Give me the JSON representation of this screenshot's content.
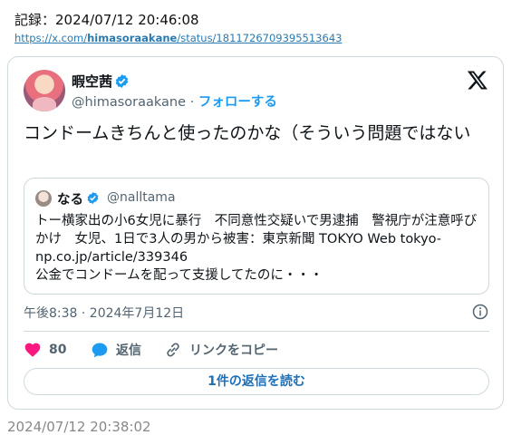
{
  "record": {
    "label": "記録：2024/07/12 20:46:08",
    "link_prefix": "https://x.com/",
    "link_user": "himasoraakane",
    "link_suffix": "/status/1811726709395513643"
  },
  "tweet": {
    "author_name": "暇空茜",
    "author_handle": "@himasoraakane",
    "separator": "·",
    "follow_label": "フォローする",
    "text": "コンドームきちんと使ったのかな（そういう問題ではない",
    "timestamp": "午後8:38 · 2024年7月12日",
    "likes_count": "80",
    "reply_label": "返信",
    "copy_link_label": "リンクをコピー",
    "read_replies_label": "1件の返信を読む"
  },
  "quote": {
    "author_name": "なる",
    "author_handle": "@nalltama",
    "line1": "トー横家出の小6女児に暴行　不同意性交疑いで男逮捕　警視庁が注意呼びかけ　女児、1日で3人の男から被害：東京新聞 TOKYO Web tokyo-np.co.jp/article/339346",
    "line2": "公金でコンドームを配って支援してたのに・・・"
  },
  "footer": {
    "record_label": "2024/07/12 20:38:02"
  },
  "colors": {
    "accent": "#1d9bf0",
    "like": "#f91880",
    "border": "#cfd9de",
    "muted": "#536471"
  },
  "icons": [
    "verified-badge-icon",
    "x-logo-icon",
    "info-icon",
    "heart-icon",
    "reply-bubble-icon",
    "link-icon"
  ]
}
